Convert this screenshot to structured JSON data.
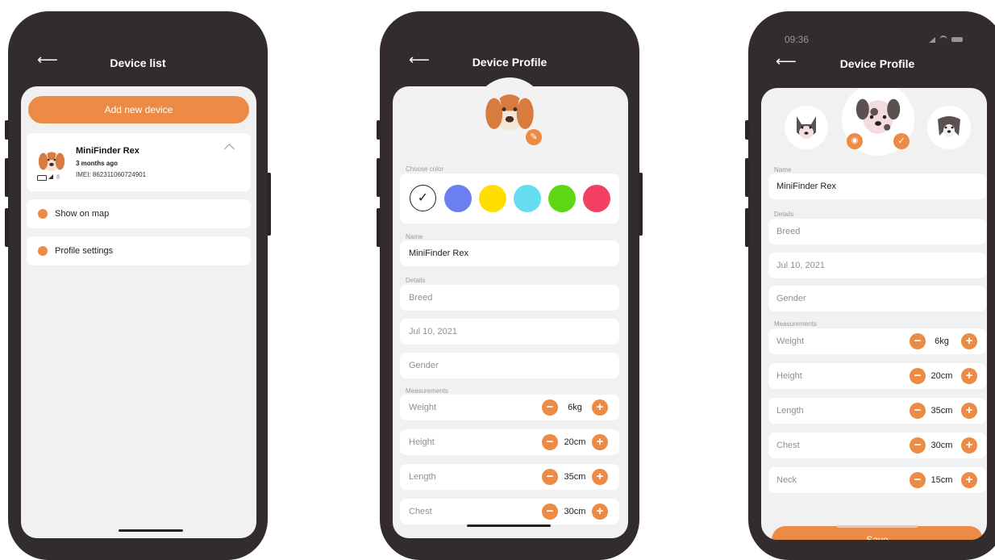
{
  "colors": {
    "accent": "#ec8b45",
    "frame": "#322d2c",
    "screen": "#f1f1f1"
  },
  "screen1": {
    "title": "Device list",
    "add_button": "Add new device",
    "device": {
      "name": "MiniFinder Rex",
      "time": "3 months ago",
      "imei": "IMEI: 862311060724901"
    },
    "menu": [
      {
        "label": "Show on map",
        "icon": "map-icon"
      },
      {
        "label": "Profile settings",
        "icon": "gear-icon"
      }
    ]
  },
  "screen2": {
    "title": "Device Profile",
    "choose_color": "Choose color",
    "swatches": [
      "#ffffff",
      "#6b7ff0",
      "#ffde00",
      "#66dcf2",
      "#5fd613",
      "#f23f62"
    ],
    "name_label": "Name",
    "name_value": "MiniFinder Rex",
    "details_label": "Details",
    "breed": "Breed",
    "date": "Jul 10, 2021",
    "gender": "Gender",
    "measurements_label": "Measurements",
    "measurements": [
      {
        "label": "Weight",
        "value": "6kg"
      },
      {
        "label": "Height",
        "value": "20cm"
      },
      {
        "label": "Length",
        "value": "35cm"
      },
      {
        "label": "Chest",
        "value": "30cm"
      }
    ]
  },
  "screen3": {
    "time": "09:36",
    "title": "Device Profile",
    "name_label": "Name",
    "name_value": "MiniFinder Rex",
    "details_label": "Details",
    "breed": "Breed",
    "date": "Jul 10, 2021",
    "gender": "Gender",
    "measurements_label": "Measurements",
    "measurements": [
      {
        "label": "Weight",
        "value": "6kg"
      },
      {
        "label": "Height",
        "value": "20cm"
      },
      {
        "label": "Length",
        "value": "35cm"
      },
      {
        "label": "Chest",
        "value": "30cm"
      },
      {
        "label": "Neck",
        "value": "15cm"
      }
    ],
    "save_button": "Save"
  }
}
